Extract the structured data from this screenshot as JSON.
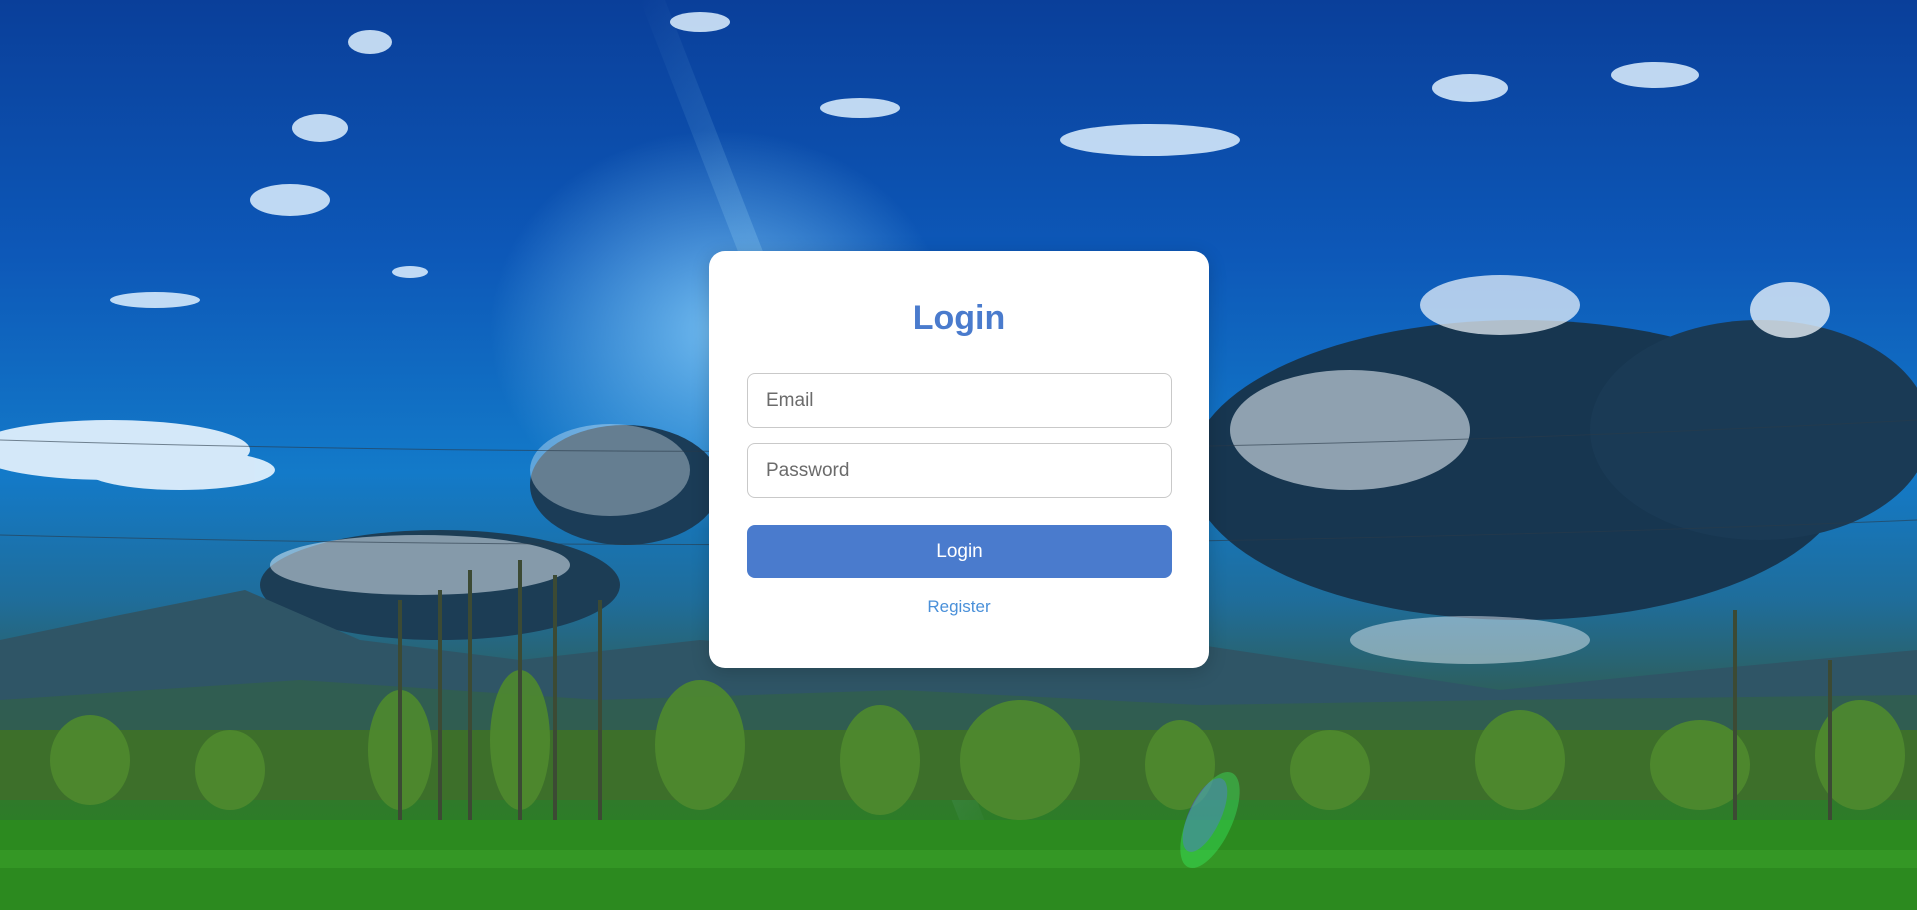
{
  "login": {
    "title": "Login",
    "email_placeholder": "Email",
    "password_placeholder": "Password",
    "submit_label": "Login",
    "register_link": "Register"
  },
  "colors": {
    "accent": "#4a7bcd",
    "link": "#4a90d9",
    "card_background": "#ffffff"
  }
}
